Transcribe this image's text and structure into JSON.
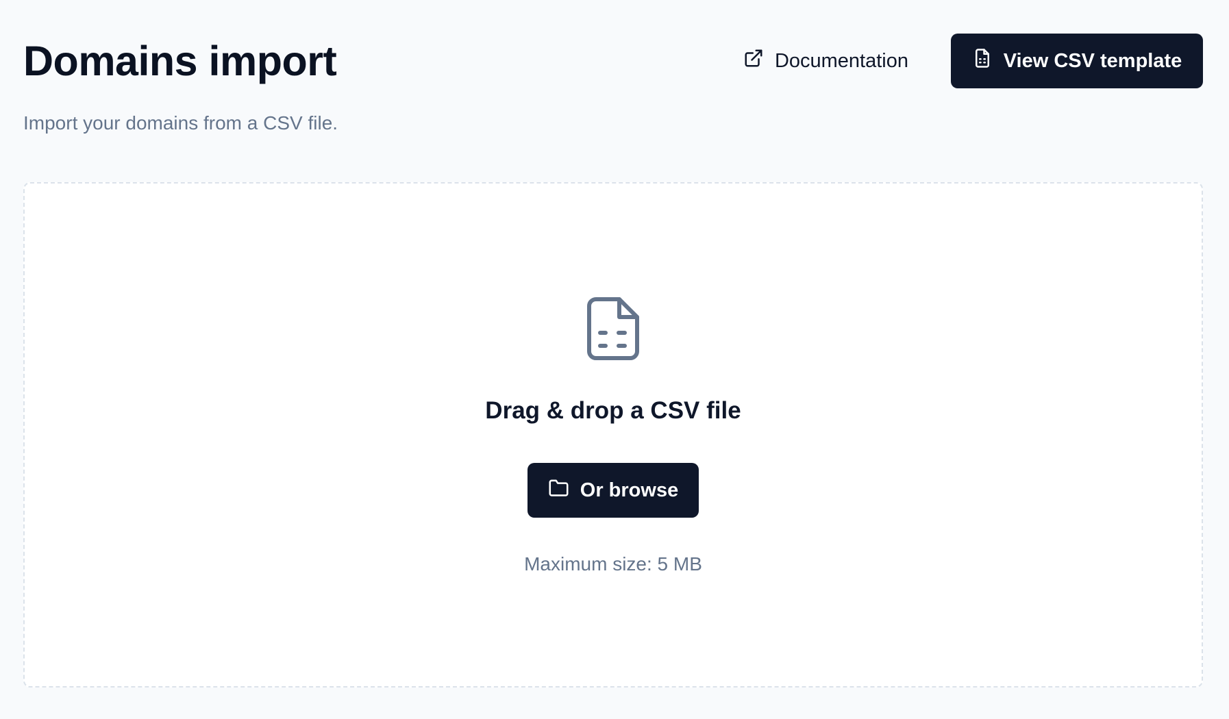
{
  "page": {
    "title": "Domains import",
    "subtitle": "Import your domains from a CSV file."
  },
  "header": {
    "documentation_label": "Documentation",
    "documentation_icon": "external-link-icon",
    "template_button_label": "View CSV template",
    "template_button_icon": "file-spreadsheet-icon"
  },
  "dropzone": {
    "icon": "file-spreadsheet-icon",
    "title": "Drag & drop a CSV file",
    "browse_label": "Or browse",
    "browse_icon": "folder-icon",
    "max_size_text": "Maximum size: 5 MB"
  },
  "colors": {
    "background": "#f8fafc",
    "primary": "#0f172a",
    "muted_text": "#64748b",
    "dropzone_border": "#dbe2ea",
    "icon_gray": "#64748b"
  }
}
